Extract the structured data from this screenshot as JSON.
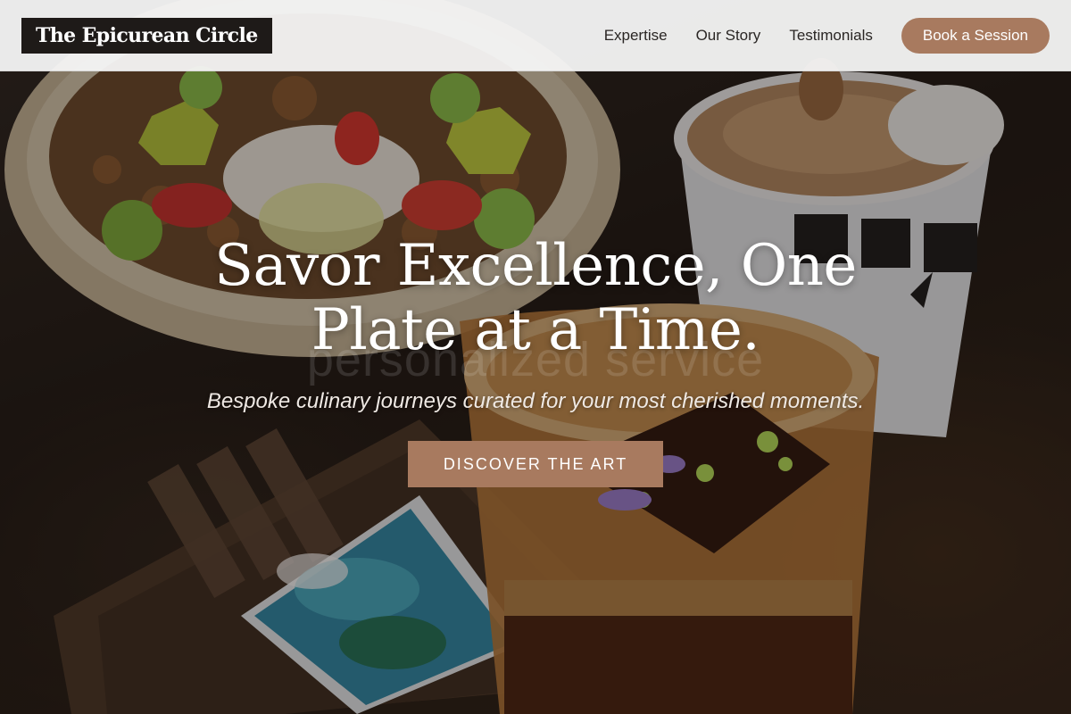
{
  "brand": {
    "name": "The Epicurean Circle"
  },
  "nav": {
    "links": [
      {
        "label": "Expertise"
      },
      {
        "label": "Our Story"
      },
      {
        "label": "Testimonials"
      }
    ],
    "cta_label": "Book a Session"
  },
  "hero": {
    "title_line1": "Savor Excellence, One",
    "title_line2": "Plate at a Time.",
    "ghost_text": "personalized service",
    "subtitle": "Bespoke culinary journeys curated for your most cherished moments.",
    "cta_label": "DISCOVER THE ART",
    "image_alt": "food-and-coffee-photo"
  },
  "colors": {
    "accent": "#a87a5f",
    "logo_bg": "#1e1a18",
    "nav_bg": "#f5f5f5"
  }
}
